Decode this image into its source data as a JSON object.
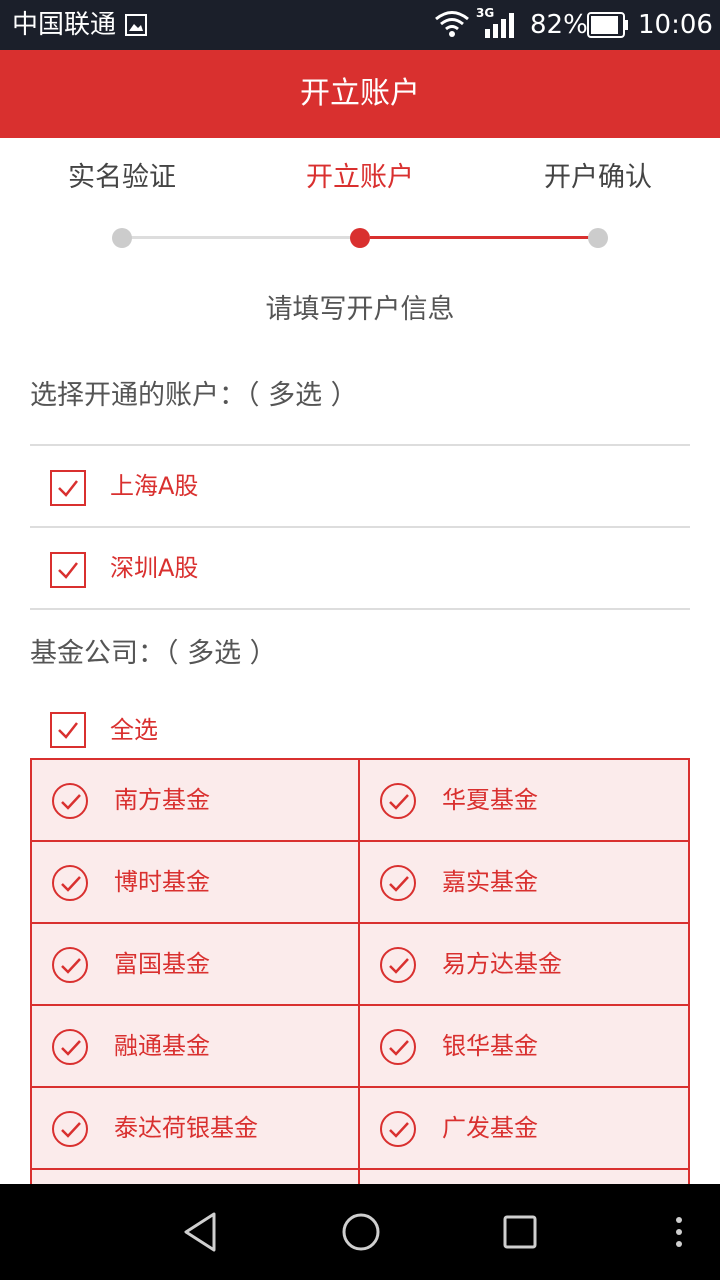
{
  "status_bar": {
    "carrier": "中国联通",
    "network_type": "3G",
    "battery": "82%",
    "time": "10:06",
    "icons": [
      "sim-icon",
      "wifi-icon",
      "signal-icon",
      "battery-icon"
    ]
  },
  "header": {
    "title": "开立账户"
  },
  "steps": [
    {
      "label": "实名验证",
      "state": "done"
    },
    {
      "label": "开立账户",
      "state": "active"
    },
    {
      "label": "开户确认",
      "state": "pending"
    }
  ],
  "subtitle": "请填写开户信息",
  "accounts": {
    "label": "选择开通的账户：（ 多选 ）",
    "items": [
      {
        "label": "上海A股",
        "checked": true
      },
      {
        "label": "深圳A股",
        "checked": true
      }
    ]
  },
  "funds": {
    "label": "基金公司：（ 多选 ）",
    "select_all": {
      "label": "全选",
      "checked": true
    },
    "items": [
      {
        "label": "南方基金",
        "checked": true
      },
      {
        "label": "华夏基金",
        "checked": true
      },
      {
        "label": "博时基金",
        "checked": true
      },
      {
        "label": "嘉实基金",
        "checked": true
      },
      {
        "label": "富国基金",
        "checked": true
      },
      {
        "label": "易方达基金",
        "checked": true
      },
      {
        "label": "融通基金",
        "checked": true
      },
      {
        "label": "银华基金",
        "checked": true
      },
      {
        "label": "泰达荷银基金",
        "checked": true
      },
      {
        "label": "广发基金",
        "checked": true
      },
      {
        "label": "",
        "checked": false
      },
      {
        "label": "",
        "checked": false
      }
    ]
  },
  "colors": {
    "accent": "#d9302f",
    "status_bar": "#1b1f2a",
    "cell_bg": "#fbebeb"
  },
  "nav_bar": {
    "icons": [
      "back-icon",
      "home-icon",
      "recents-icon",
      "more-icon"
    ]
  }
}
